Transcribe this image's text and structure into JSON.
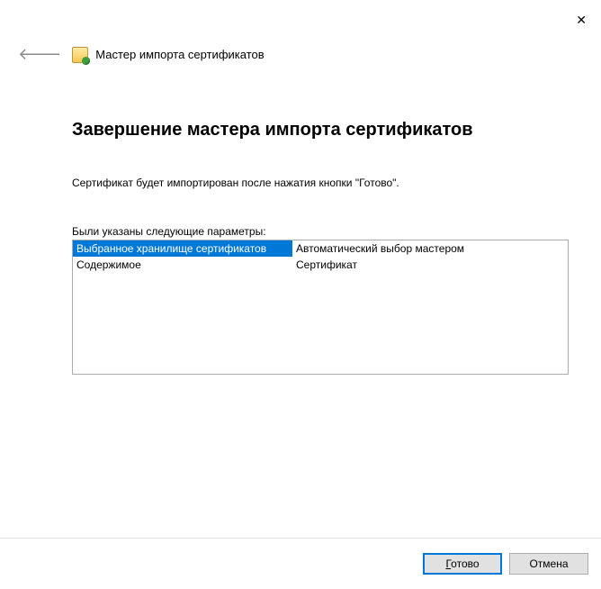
{
  "header": {
    "wizard_title": "Мастер импорта сертификатов"
  },
  "main": {
    "heading": "Завершение мастера импорта сертификатов",
    "body": "Сертификат будет импортирован после нажатия кнопки \"Готово\".",
    "params_label": "Были указаны следующие параметры:",
    "rows": [
      {
        "label": "Выбранное хранилище сертификатов",
        "value": "Автоматический выбор мастером"
      },
      {
        "label": "Содержимое",
        "value": "Сертификат"
      }
    ]
  },
  "footer": {
    "finish_accel": "Г",
    "finish_rest": "отово",
    "cancel": "Отмена"
  }
}
